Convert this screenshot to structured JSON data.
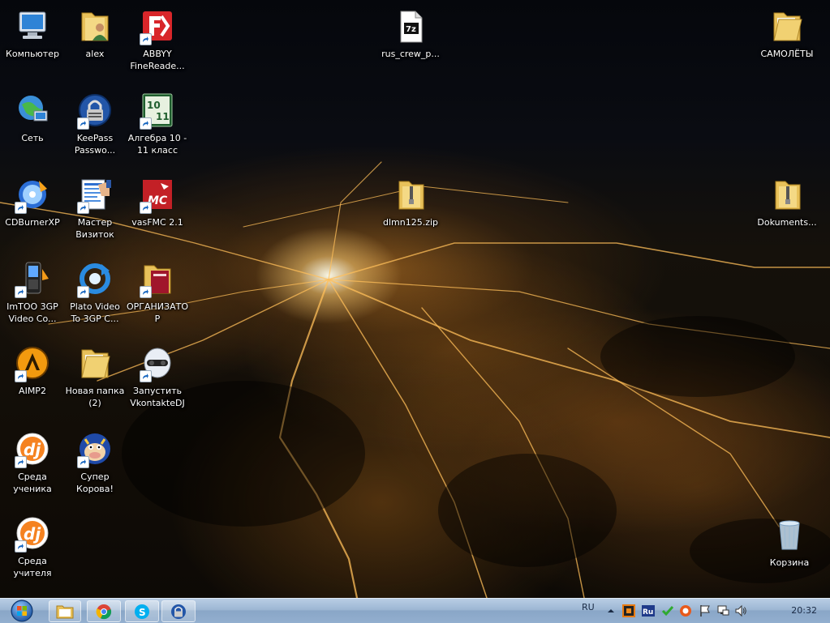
{
  "desktop": {
    "icons": [
      {
        "label": "Компьютер",
        "icon": "computer-icon"
      },
      {
        "label": "alex",
        "icon": "user-folder-icon"
      },
      {
        "label": "ABBYY FineReade...",
        "icon": "abbyy-icon",
        "shortcut": true
      },
      {
        "label": "rus_crew_p...",
        "icon": "7z-archive-icon"
      },
      {
        "label": "САМОЛЁТЫ",
        "icon": "folder-icon"
      },
      {
        "label": "Сеть",
        "icon": "network-icon"
      },
      {
        "label": "KeePass Passwo...",
        "icon": "keepass-icon",
        "shortcut": true
      },
      {
        "label": "Алгебра 10 - 11 класс",
        "icon": "algebra-icon",
        "shortcut": true
      },
      {
        "label": "CDBurnerXP",
        "icon": "cdburner-icon",
        "shortcut": true
      },
      {
        "label": "Мастер Визиток",
        "icon": "business-card-icon",
        "shortcut": true
      },
      {
        "label": "vasFMC 2.1",
        "icon": "vasfmc-icon",
        "shortcut": true
      },
      {
        "label": "dlmn125.zip",
        "icon": "zip-folder-icon"
      },
      {
        "label": "Dokuments...",
        "icon": "zip-folder-icon"
      },
      {
        "label": "ImTOO 3GP Video Co...",
        "icon": "phone-icon",
        "shortcut": true
      },
      {
        "label": "Plato Video To 3GP C...",
        "icon": "plato-icon",
        "shortcut": true
      },
      {
        "label": "ОРГАНИЗАТОР",
        "icon": "organizer-icon",
        "shortcut": true
      },
      {
        "label": "AIMP2",
        "icon": "aimp-icon",
        "shortcut": true
      },
      {
        "label": "Новая папка (2)",
        "icon": "folder-icon"
      },
      {
        "label": "Запустить VkontakteDJ",
        "icon": "vkontaktedj-icon",
        "shortcut": true
      },
      {
        "label": "Среда ученика",
        "icon": "dj-icon",
        "shortcut": true
      },
      {
        "label": "Супер Корова!",
        "icon": "cow-icon",
        "shortcut": true
      },
      {
        "label": "Среда учителя",
        "icon": "dj-icon",
        "shortcut": true
      },
      {
        "label": "Корзина",
        "icon": "recycle-bin-icon"
      }
    ]
  },
  "taskbar": {
    "start": "windows-start-icon",
    "pinned": [
      "explorer-icon",
      "chrome-icon",
      "skype-icon",
      "keepass-icon"
    ],
    "tray": {
      "language": "RU",
      "clock": "20:32",
      "icons": [
        "show-hidden-icons-icon",
        "app-tray-icon",
        "punto-switcher-icon",
        "tick-icon",
        "browser-tray-icon",
        "action-center-flag-icon",
        "network-tray-icon",
        "volume-icon"
      ]
    }
  }
}
